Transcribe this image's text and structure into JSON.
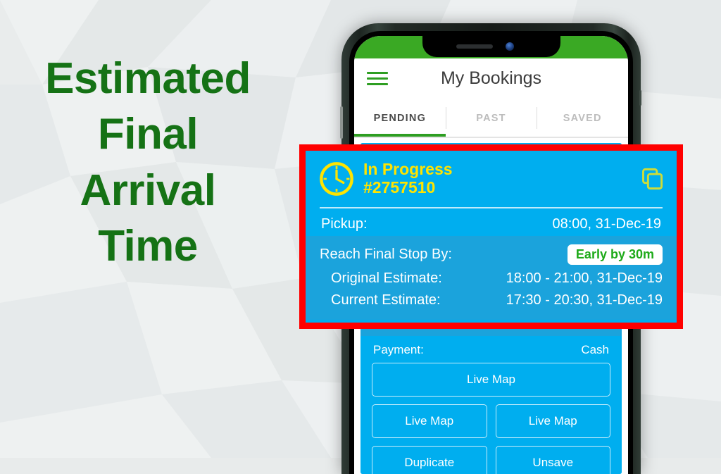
{
  "headline": {
    "lines": [
      "Estimated",
      "Final",
      "Arrival",
      "Time"
    ],
    "color": "#157215"
  },
  "colors": {
    "brand_green": "#3aa924",
    "card_blue": "#00aeef",
    "card_blue_dark": "#1ba3dc",
    "highlight_red": "#ff0000",
    "accent_yellow": "#ffe400",
    "badge_green": "#1eaa19",
    "background": "#e8ebeb"
  },
  "app": {
    "menu_icon": "hamburger-menu-icon",
    "title": "My Bookings",
    "tabs": [
      {
        "label": "PENDING",
        "active": true
      },
      {
        "label": "PAST",
        "active": false
      },
      {
        "label": "SAVED",
        "active": false
      }
    ]
  },
  "booking_card": {
    "status_icon": "clock-icon",
    "status": "In Progress",
    "booking_id": "#2757510",
    "copy_icon": "copy-duplicate-icon",
    "pickup": {
      "label": "Pickup:",
      "value": "08:00, 31-Dec-19"
    },
    "reach_final_stop": {
      "label": "Reach Final Stop By:",
      "badge": "Early by 30m"
    },
    "original_estimate": {
      "label": "Original Estimate:",
      "value": "18:00 - 21:00, 31-Dec-19"
    },
    "current_estimate": {
      "label": "Current Estimate:",
      "value": "17:30 - 20:30, 31-Dec-19"
    },
    "payment": {
      "label": "Payment:",
      "value": "Cash"
    },
    "buttons": {
      "primary": "Live Map",
      "secondary_left": "Live Map",
      "secondary_right": "Live Map",
      "tertiary_left": "Duplicate",
      "tertiary_right": "Unsave"
    }
  }
}
